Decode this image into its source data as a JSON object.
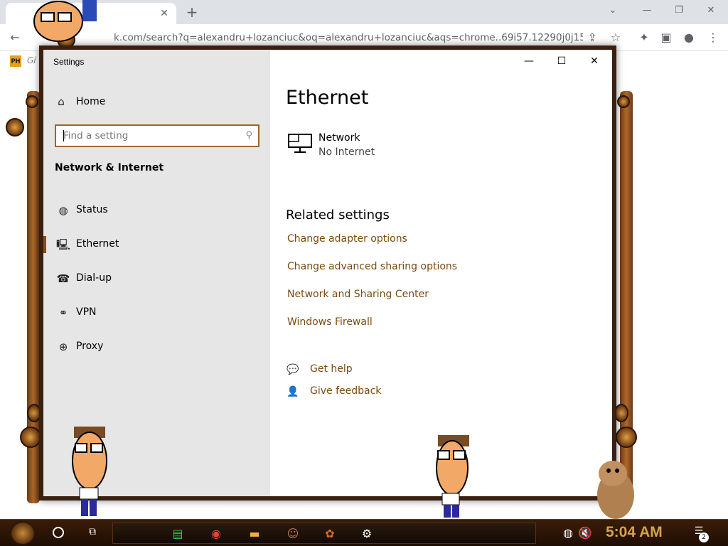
{
  "browser": {
    "url": "k.com/search?q=alexandru+lozanciuc&oq=alexandru+lozanciuc&aqs=chrome..69i57.12290j0j15&s...",
    "bookmark_badge": "PH",
    "bookmark_text": "Gi"
  },
  "settings": {
    "window_title": "Settings",
    "home_label": "Home",
    "search_placeholder": "Find a setting",
    "section_header": "Network & Internet",
    "nav": [
      {
        "label": "Status",
        "icon": "globe-icon"
      },
      {
        "label": "Ethernet",
        "icon": "ethernet-icon",
        "active": true
      },
      {
        "label": "Dial-up",
        "icon": "dialup-icon"
      },
      {
        "label": "VPN",
        "icon": "vpn-icon"
      },
      {
        "label": "Proxy",
        "icon": "proxy-globe-icon"
      }
    ],
    "page_title": "Ethernet",
    "network_name": "Network",
    "network_status": "No Internet",
    "related_header": "Related settings",
    "related_links": [
      "Change adapter options",
      "Change advanced sharing options",
      "Network and Sharing Center",
      "Windows Firewall"
    ],
    "help": [
      {
        "label": "Get help",
        "icon": "get-help-icon"
      },
      {
        "label": "Give feedback",
        "icon": "feedback-icon"
      }
    ],
    "accent_color": "#8a4f18"
  },
  "taskbar": {
    "clock": "5:04 AM",
    "notification_count": "2"
  }
}
